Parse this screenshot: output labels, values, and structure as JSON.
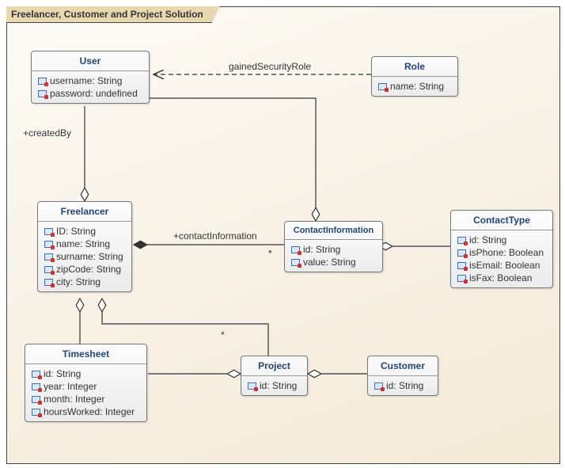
{
  "frame_title": "Freelancer, Customer and Project Solution",
  "classes": {
    "user": {
      "name": "User",
      "attrs": [
        {
          "label": "username: String"
        },
        {
          "label": "password: undefined"
        }
      ]
    },
    "role": {
      "name": "Role",
      "attrs": [
        {
          "label": "name: String"
        }
      ]
    },
    "freelancer": {
      "name": "Freelancer",
      "attrs": [
        {
          "label": "ID: String"
        },
        {
          "label": "name: String"
        },
        {
          "label": "surname: String"
        },
        {
          "label": "zipCode: String"
        },
        {
          "label": "city: String"
        }
      ]
    },
    "contactInformation": {
      "name": "ContactInformation",
      "attrs": [
        {
          "label": "id: String"
        },
        {
          "label": "value: String"
        }
      ]
    },
    "contactType": {
      "name": "ContactType",
      "attrs": [
        {
          "label": "id: String"
        },
        {
          "label": "isPhone: Boolean"
        },
        {
          "label": "isEmail: Boolean"
        },
        {
          "label": "isFax: Boolean"
        }
      ]
    },
    "timesheet": {
      "name": "Timesheet",
      "attrs": [
        {
          "label": "id: String"
        },
        {
          "label": "year: Integer"
        },
        {
          "label": "month: Integer"
        },
        {
          "label": "hoursWorked: Integer"
        }
      ]
    },
    "project": {
      "name": "Project",
      "attrs": [
        {
          "label": "id: String"
        }
      ]
    },
    "customer": {
      "name": "Customer",
      "attrs": [
        {
          "label": "id: String"
        }
      ]
    }
  },
  "edges": {
    "gainedSecurityRole": "gainedSecurityRole",
    "createdBy": "+createdBy",
    "contactInformation": "+contactInformation",
    "star1": "*",
    "star2": "*"
  },
  "chart_data": {
    "type": "uml-class-diagram",
    "title": "Freelancer, Customer and Project Solution",
    "classes": [
      {
        "name": "User",
        "attributes": [
          "username: String",
          "password: undefined"
        ]
      },
      {
        "name": "Role",
        "attributes": [
          "name: String"
        ]
      },
      {
        "name": "Freelancer",
        "attributes": [
          "ID: String",
          "name: String",
          "surname: String",
          "zipCode: String",
          "city: String"
        ]
      },
      {
        "name": "ContactInformation",
        "attributes": [
          "id: String",
          "value: String"
        ]
      },
      {
        "name": "ContactType",
        "attributes": [
          "id: String",
          "isPhone: Boolean",
          "isEmail: Boolean",
          "isFax: Boolean"
        ]
      },
      {
        "name": "Timesheet",
        "attributes": [
          "id: String",
          "year: Integer",
          "month: Integer",
          "hoursWorked: Integer"
        ]
      },
      {
        "name": "Project",
        "attributes": [
          "id: String"
        ]
      },
      {
        "name": "Customer",
        "attributes": [
          "id: String"
        ]
      }
    ],
    "relationships": [
      {
        "from": "Role",
        "to": "User",
        "type": "dependency-dashed-arrow",
        "label": "gainedSecurityRole"
      },
      {
        "from": "User",
        "to": "Freelancer",
        "type": "aggregation",
        "label": "+createdBy",
        "diamond_at": "Freelancer"
      },
      {
        "from": "User",
        "to": "ContactInformation",
        "type": "aggregation",
        "diamond_at": "ContactInformation"
      },
      {
        "from": "Freelancer",
        "to": "ContactInformation",
        "type": "composition",
        "label": "+contactInformation",
        "multiplicity_to": "*",
        "diamond_at": "Freelancer"
      },
      {
        "from": "ContactType",
        "to": "ContactInformation",
        "type": "aggregation",
        "diamond_at": "ContactInformation"
      },
      {
        "from": "Freelancer",
        "to": "Timesheet",
        "type": "aggregation",
        "diamond_at": "Freelancer"
      },
      {
        "from": "Freelancer",
        "to": "Project",
        "type": "aggregation",
        "multiplicity_to": "*",
        "diamond_at": "Freelancer"
      },
      {
        "from": "Timesheet",
        "to": "Project",
        "type": "aggregation",
        "diamond_at": "Project"
      },
      {
        "from": "Project",
        "to": "Customer",
        "type": "aggregation",
        "diamond_at": "Project"
      }
    ]
  }
}
